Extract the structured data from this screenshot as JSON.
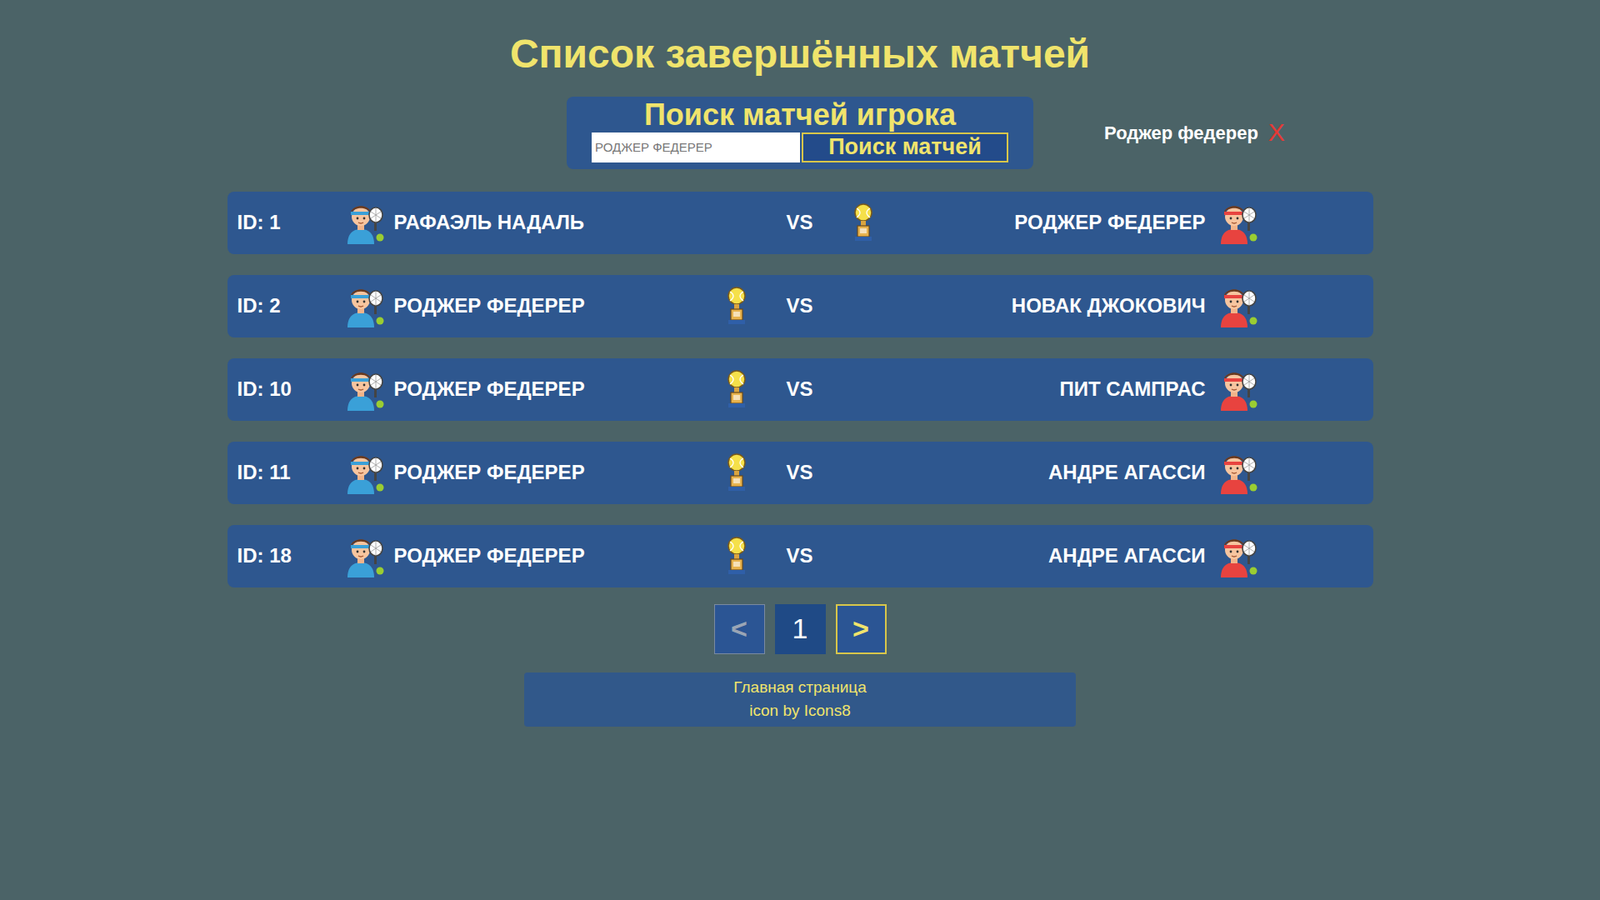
{
  "page": {
    "title": "Список завершённых матчей"
  },
  "search": {
    "title": "Поиск матчей игрока",
    "value": "РОДЖЕР ФЕДЕРЕР",
    "button": "Поиск матчей"
  },
  "filter": {
    "label": "Роджер федерер",
    "clear": "X"
  },
  "vs_label": "VS",
  "matches": [
    {
      "id": "ID: 1",
      "players": [
        {
          "name": "РАФАЭЛЬ НАДАЛЬ",
          "winner": false
        },
        {
          "name": "РОДЖЕР ФЕДЕРЕР",
          "winner": true
        }
      ]
    },
    {
      "id": "ID: 2",
      "players": [
        {
          "name": "РОДЖЕР ФЕДЕРЕР",
          "winner": true
        },
        {
          "name": "НОВАК ДЖОКОВИЧ",
          "winner": false
        }
      ]
    },
    {
      "id": "ID: 10",
      "players": [
        {
          "name": "РОДЖЕР ФЕДЕРЕР",
          "winner": true
        },
        {
          "name": "ПИТ САМПРАС",
          "winner": false
        }
      ]
    },
    {
      "id": "ID: 11",
      "players": [
        {
          "name": "РОДЖЕР ФЕДЕРЕР",
          "winner": true
        },
        {
          "name": "АНДРЕ АГАССИ",
          "winner": false
        }
      ]
    },
    {
      "id": "ID: 18",
      "players": [
        {
          "name": "РОДЖЕР ФЕДЕРЕР",
          "winner": true
        },
        {
          "name": "АНДРЕ АГАССИ",
          "winner": false
        }
      ]
    }
  ],
  "pagination": {
    "prev": {
      "label": "<",
      "disabled": true
    },
    "pages": [
      {
        "label": "1",
        "selected": true
      }
    ],
    "next": {
      "label": ">",
      "disabled": false
    }
  },
  "footer": {
    "links": [
      "Главная страница",
      "icon by Icons8"
    ]
  }
}
